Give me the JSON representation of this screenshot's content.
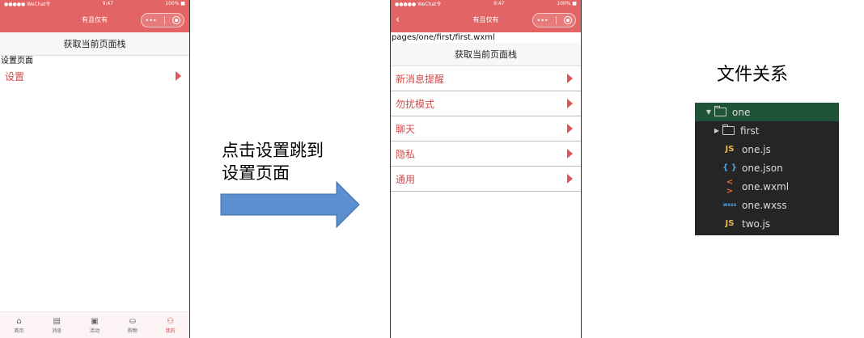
{
  "phone1": {
    "status": {
      "carrier": "●●●●● WeChat令",
      "time": "9:47",
      "battery": "100% ■"
    },
    "title": "有且仅有",
    "capsule": {
      "more": "•••"
    },
    "stack_button": "获取当前页面栈",
    "page_label": "设置页面",
    "items": [
      {
        "label": "设置"
      }
    ],
    "tabs": [
      {
        "label": "首页",
        "icon": "⌂"
      },
      {
        "label": "消息",
        "icon": "▤"
      },
      {
        "label": "活动",
        "icon": "▣"
      },
      {
        "label": "购物",
        "icon": "⛀"
      },
      {
        "label": "我的",
        "icon": "⚇"
      }
    ]
  },
  "annotation": {
    "line1": "点击设置跳到",
    "line2": "设置页面"
  },
  "phone2": {
    "status": {
      "carrier": "●●●●● WeChat令",
      "time": "9:47",
      "battery": "100% ■"
    },
    "title": "有且仅有",
    "capsule": {
      "more": "•••"
    },
    "back": "‹",
    "path": "pages/one/first/first.wxml",
    "stack_button": "获取当前页面栈",
    "items": [
      {
        "label": "新消息提醒"
      },
      {
        "label": "勿扰模式"
      },
      {
        "label": "聊天"
      },
      {
        "label": "隐私"
      },
      {
        "label": "通用"
      }
    ]
  },
  "file_relation": {
    "heading": "文件关系",
    "tree": [
      {
        "name": "one",
        "indent": 0,
        "type": "folder",
        "expanded": true,
        "icon": "folder-open-icon"
      },
      {
        "name": "first",
        "indent": 1,
        "type": "folder",
        "expanded": false,
        "icon": "folder-icon"
      },
      {
        "name": "one.js",
        "indent": 2,
        "type": "js",
        "badge": "JS",
        "color": "#e8b84a"
      },
      {
        "name": "one.json",
        "indent": 2,
        "type": "json",
        "badge": "{ }",
        "color": "#4fa3e0"
      },
      {
        "name": "one.wxml",
        "indent": 2,
        "type": "wxml",
        "badge": "< >",
        "color": "#e06c3a"
      },
      {
        "name": "one.wxss",
        "indent": 2,
        "type": "wxss",
        "badge": "wxss",
        "color": "#4fa3e0"
      },
      {
        "name": "two.js",
        "indent": 2,
        "type": "js",
        "badge": "JS",
        "color": "#e8b84a"
      }
    ]
  },
  "colors": {
    "accent": "#e36464",
    "item_text": "#d24a4a",
    "arrow": "#5b8fd0"
  }
}
